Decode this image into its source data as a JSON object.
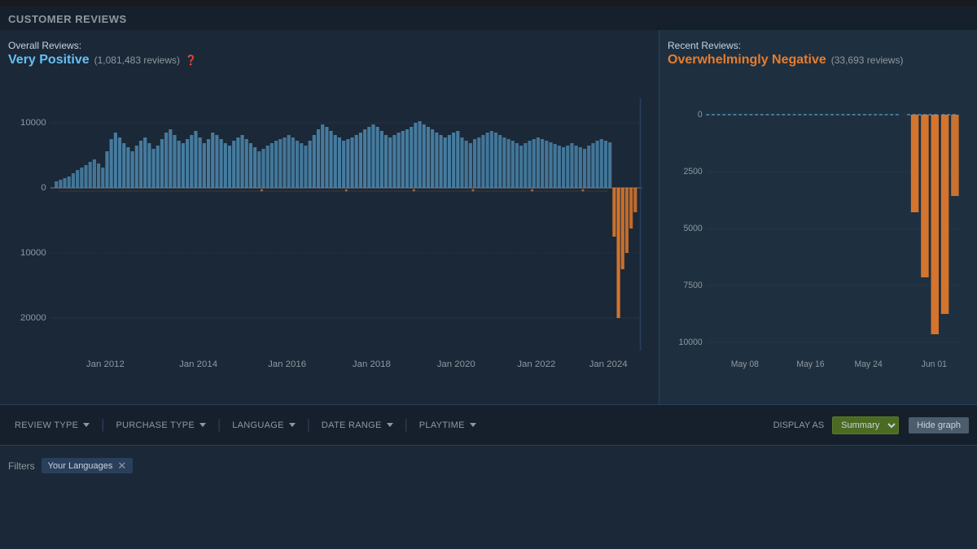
{
  "header": {
    "title": "CUSTOMER REVIEWS"
  },
  "overall": {
    "label": "Overall Reviews:",
    "score": "Very Positive",
    "score_class": "positive",
    "count": "(1,081,483 reviews)"
  },
  "recent": {
    "label": "Recent Reviews:",
    "score": "Overwhelmingly Negative",
    "score_class": "negative",
    "count": "(33,693 reviews)"
  },
  "filters": {
    "review_type": "REVIEW TYPE",
    "purchase_type": "PURCHASE TYPE",
    "language": "LANGUAGE",
    "date_range": "DATE RANGE",
    "playtime": "PLAYTIME",
    "display_as": "DISPLAY AS",
    "summary": "Summary",
    "hide_graph": "Hide graph"
  },
  "filter_bar": {
    "filters_label": "Filters",
    "active_filter": "Your Languages"
  },
  "overall_chart": {
    "y_labels": [
      "10000",
      "0",
      "10000",
      "20000"
    ],
    "x_labels": [
      "Jan 2012",
      "Jan 2014",
      "Jan 2016",
      "Jan 2018",
      "Jan 2020",
      "Jan 2022",
      "Jan 2024"
    ]
  },
  "recent_chart": {
    "y_labels": [
      "0",
      "2500",
      "5000",
      "7500",
      "10000"
    ],
    "x_labels": [
      "May 08",
      "May 16",
      "May 24",
      "Jun 01"
    ]
  }
}
